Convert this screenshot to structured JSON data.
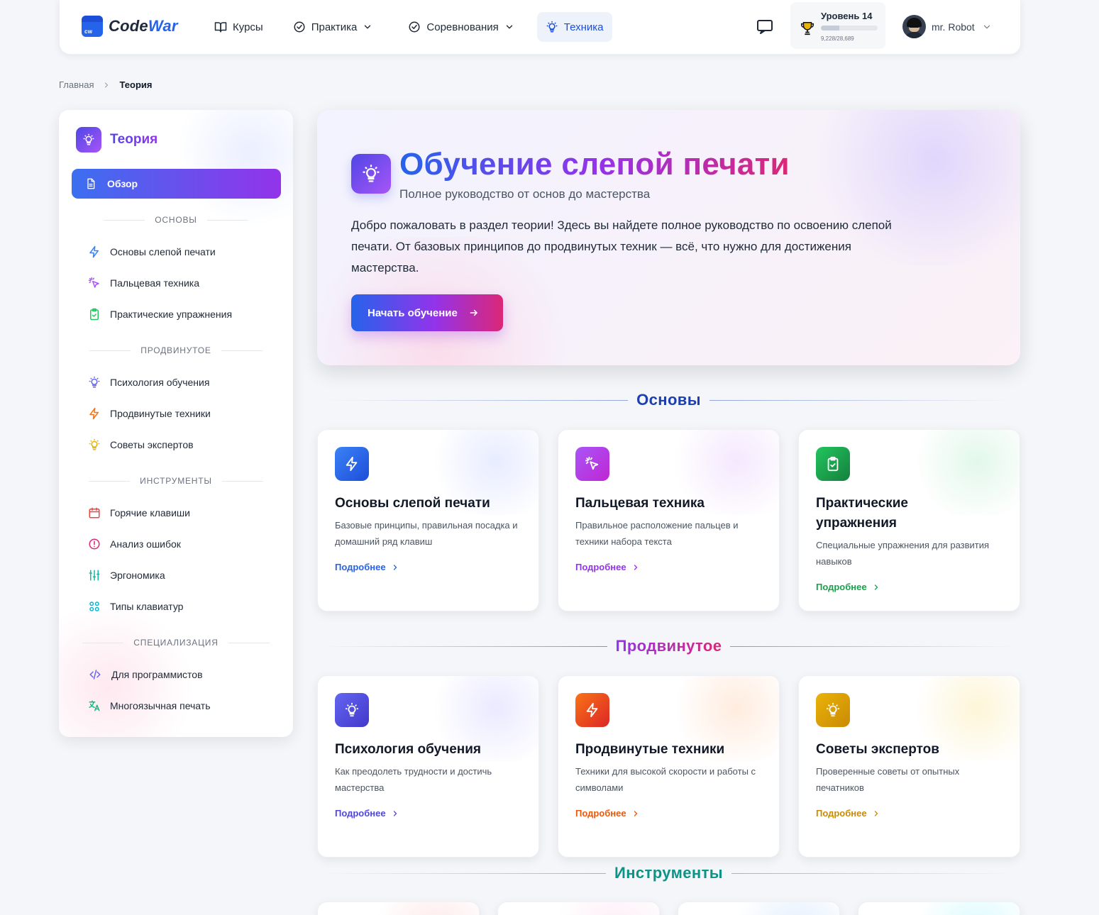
{
  "header": {
    "logo": {
      "badge": "cw",
      "name_part1": "Code",
      "name_part2": "War"
    },
    "nav": [
      {
        "label": "Курсы",
        "icon": "book-icon"
      },
      {
        "label": "Практика",
        "icon": "check-circle-icon"
      },
      {
        "label": "Соревнования",
        "icon": "check-circle-icon"
      },
      {
        "label": "Техника",
        "icon": "lightbulb-icon",
        "active": true
      }
    ],
    "level": {
      "label": "Уровень 14",
      "xp": "9,228/28,689",
      "progress": 0.32
    },
    "user": {
      "name": "mr. Robot"
    }
  },
  "breadcrumb": {
    "home": "Главная",
    "current": "Теория"
  },
  "sidebar": {
    "title": "Теория",
    "active_item": "Обзор",
    "sections": [
      {
        "title": "ОСНОВЫ",
        "items": [
          {
            "label": "Основы слепой печати",
            "icon": "bolt-icon",
            "color": "#3b82f6"
          },
          {
            "label": "Пальцевая техника",
            "icon": "cursor-click-icon",
            "color": "#a855f7"
          },
          {
            "label": "Практические упражнения",
            "icon": "clipboard-check-icon",
            "color": "#22c55e"
          }
        ]
      },
      {
        "title": "ПРОДВИНУТОЕ",
        "items": [
          {
            "label": "Психология обучения",
            "icon": "lightbulb-icon",
            "color": "#6366f1"
          },
          {
            "label": "Продвинутые техники",
            "icon": "bolt-icon",
            "color": "#f97316"
          },
          {
            "label": "Советы экспертов",
            "icon": "lightbulb-icon",
            "color": "#eab308"
          }
        ]
      },
      {
        "title": "ИНСТРУМЕНТЫ",
        "items": [
          {
            "label": "Горячие клавиши",
            "icon": "calendar-icon",
            "color": "#ef4444"
          },
          {
            "label": "Анализ ошибок",
            "icon": "alert-circle-icon",
            "color": "#db2777"
          },
          {
            "label": "Эргономика",
            "icon": "sliders-icon",
            "color": "#14b8a6"
          },
          {
            "label": "Типы клавиатур",
            "icon": "grid-icon",
            "color": "#06b6d4"
          }
        ]
      },
      {
        "title": "СПЕЦИАЛИЗАЦИЯ",
        "items": [
          {
            "label": "Для программистов",
            "icon": "code-icon",
            "color": "#6366f1"
          },
          {
            "label": "Многоязычная печать",
            "icon": "translate-icon",
            "color": "#10b981"
          }
        ]
      }
    ]
  },
  "hero": {
    "title": "Обучение слепой печати",
    "subtitle": "Полное руководство от основ до мастерства",
    "description": "Добро пожаловать в раздел теории! Здесь вы найдете полное руководство по освоению слепой печати. От базовых принципов до продвинутых техник — всё, что нужно для достижения мастерства.",
    "button": "Начать обучение"
  },
  "sections": [
    {
      "title": "Основы",
      "color": "#1e40af",
      "cards": [
        {
          "title": "Основы слепой печати",
          "description": "Базовые принципы, правильная посадка и домашний ряд клавиш",
          "more": "Подробнее",
          "icon": "bolt-icon",
          "color": "#2563eb"
        },
        {
          "title": "Пальцевая техника",
          "description": "Правильное расположение пальцев и техники набора текста",
          "more": "Подробнее",
          "icon": "cursor-click-icon",
          "color": "#9333ea"
        },
        {
          "title": "Практические упражнения",
          "description": "Специальные упражнения для развития навыков",
          "more": "Подробнее",
          "icon": "clipboard-check-icon",
          "color": "#16a34a"
        }
      ]
    },
    {
      "title": "Продвинутое",
      "color": "#9333ea",
      "cards": [
        {
          "title": "Психология обучения",
          "description": "Как преодолеть трудности и достичь мастерства",
          "more": "Подробнее",
          "icon": "lightbulb-icon",
          "color": "#4f46e5"
        },
        {
          "title": "Продвинутые техники",
          "description": "Техники для высокой скорости и работы с символами",
          "more": "Подробнее",
          "icon": "bolt-icon",
          "color": "#ea580c"
        },
        {
          "title": "Советы экспертов",
          "description": "Проверенные советы от опытных печатников",
          "more": "Подробнее",
          "icon": "lightbulb-icon",
          "color": "#ca8a04"
        }
      ]
    },
    {
      "title": "Инструменты",
      "color": "#0d9488"
    }
  ]
}
